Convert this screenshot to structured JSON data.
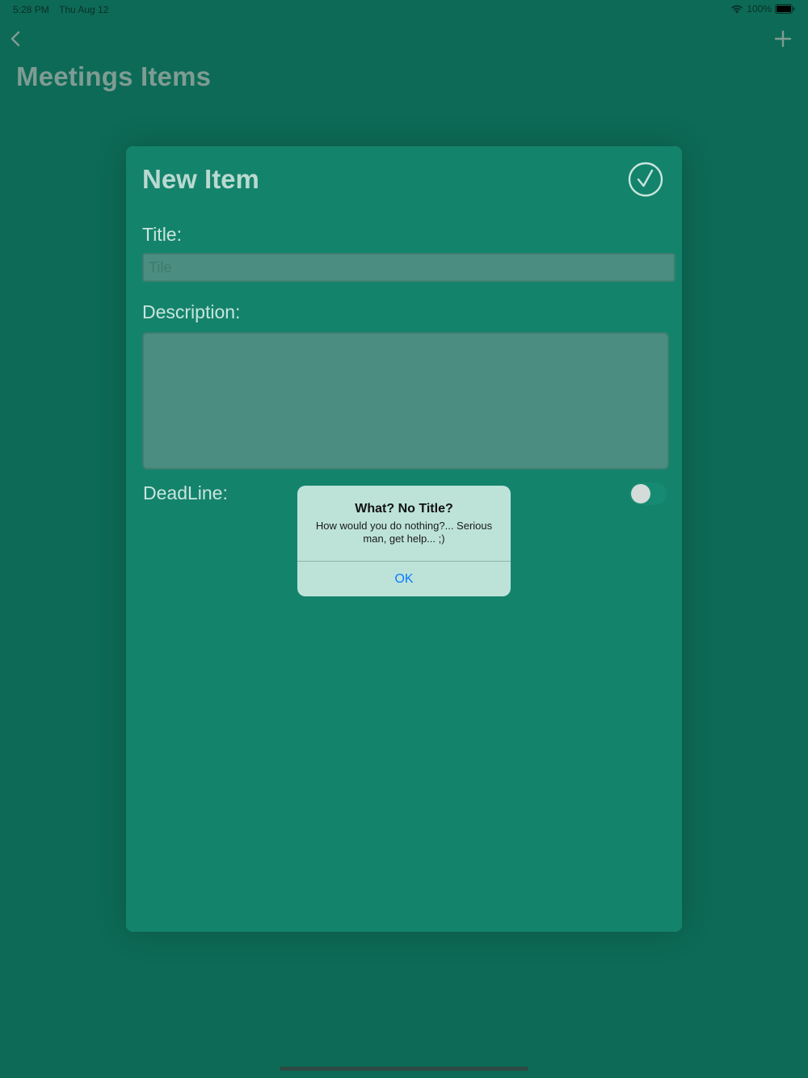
{
  "status_bar": {
    "time": "5:28 PM",
    "date": "Thu Aug 12",
    "battery": "100%",
    "icons": [
      "wifi-icon",
      "battery-icon"
    ]
  },
  "nav": {
    "title": "Meetings Items",
    "back_icon": "chevron-left-icon",
    "add_icon": "plus-icon"
  },
  "sheet": {
    "title": "New Item",
    "confirm_icon": "checkmark-circle-icon",
    "title_label": "Title:",
    "title_placeholder": "Tile",
    "title_value": "",
    "description_label": "Description:",
    "description_value": "",
    "deadline_label": "DeadLine:",
    "deadline_enabled": false
  },
  "alert": {
    "title": "What? No Title?",
    "message": "How would you do nothing?... Serious man, get help... ;)",
    "ok_label": "OK"
  },
  "colors": {
    "background": "#0d6a56",
    "sheet": "#14836c",
    "alert": "#bde3d9",
    "accent": "#0a7bff"
  }
}
